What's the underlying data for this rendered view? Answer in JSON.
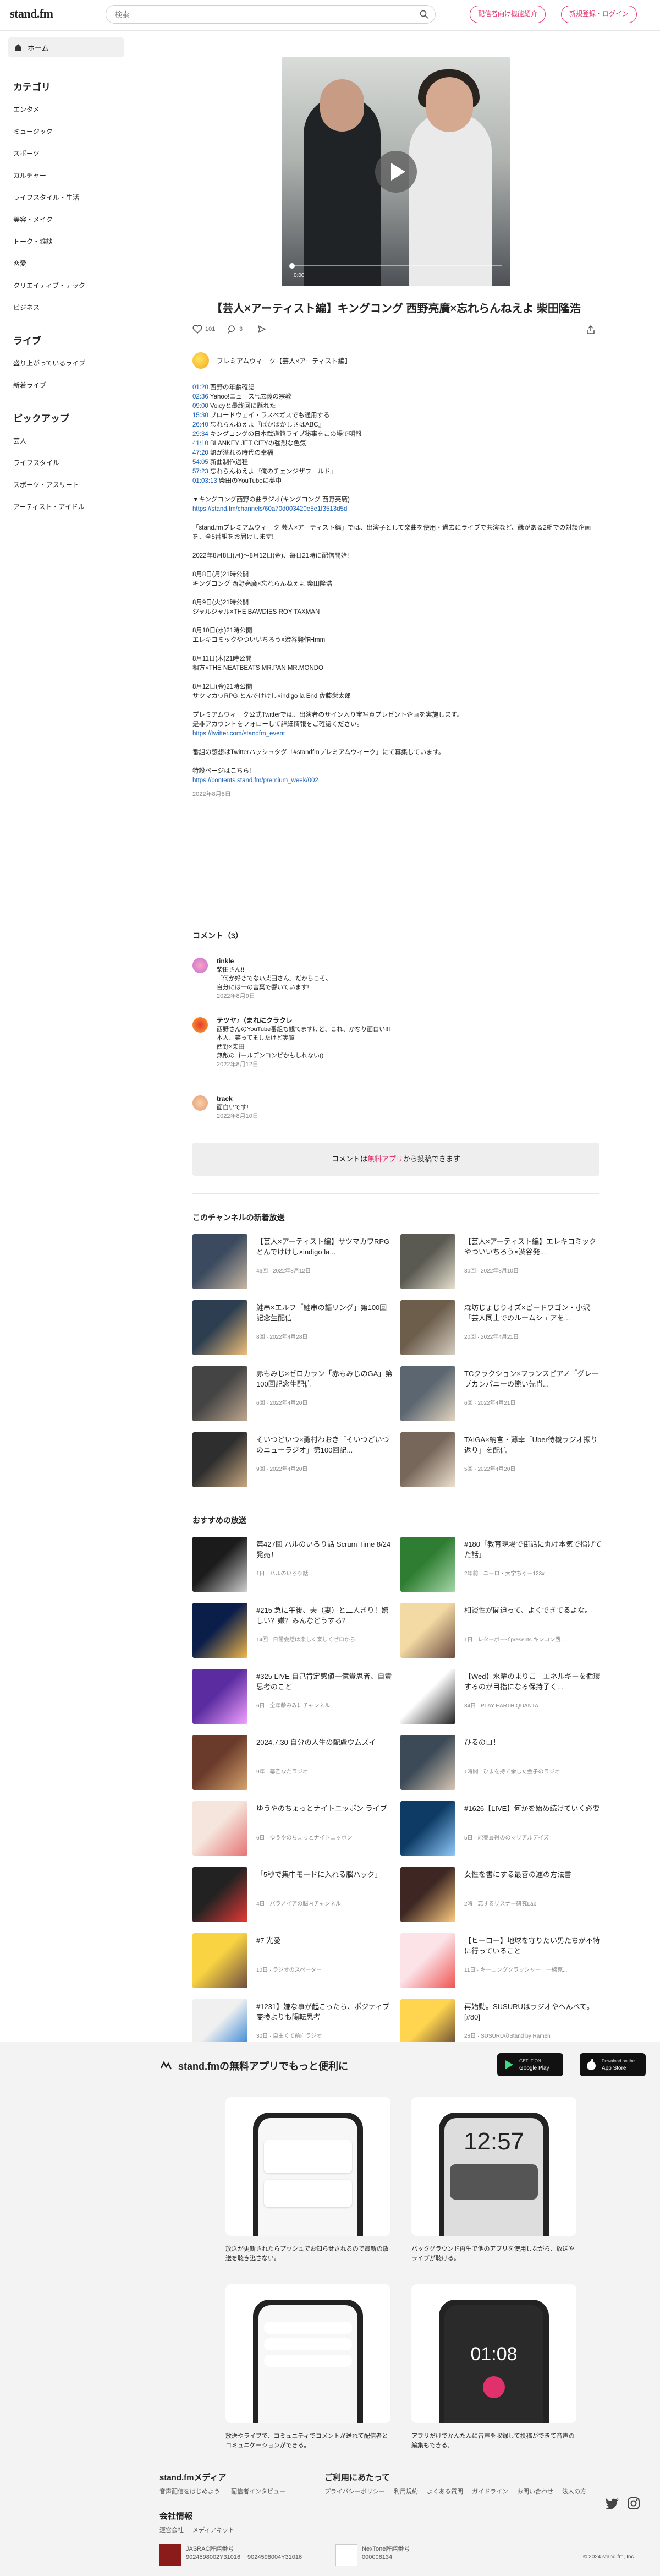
{
  "header": {
    "logo": "stand.fm",
    "search_placeholder": "検索",
    "btn_distributor": "配信者向け機能紹介",
    "btn_signup": "新規登録・ログイン"
  },
  "sidebar": {
    "home": "ホーム",
    "categories_title": "カテゴリ",
    "categories": [
      "エンタメ",
      "ミュージック",
      "スポーツ",
      "カルチャー",
      "ライフスタイル・生活",
      "美容・メイク",
      "トーク・雑談",
      "恋愛",
      "クリエイティブ・テック",
      "ビジネス"
    ],
    "live_title": "ライブ",
    "live": [
      "盛り上がっているライブ",
      "新着ライブ"
    ],
    "pickup_title": "ピックアップ",
    "pickup": [
      "芸人",
      "ライフスタイル",
      "スポーツ・アスリート",
      "アーティスト・アイドル"
    ]
  },
  "player": {
    "time": "0:00"
  },
  "episode": {
    "title": "【芸人×アーティスト編】キングコング 西野亮廣×忘れらんねえよ 柴田隆浩",
    "likes": "101",
    "comments": "3",
    "channel": "プレミアムウィーク【芸人×アーティスト編】"
  },
  "chapters": [
    {
      "t": "01:20",
      "s": "西野の年齢確認"
    },
    {
      "t": "02:36",
      "s": "Yahoo!ニュース≒広義の宗教"
    },
    {
      "t": "09:00",
      "s": "Voicyと最終回に懸れた"
    },
    {
      "t": "15:30",
      "s": "ブロードウェイ・ラスベガスでも通用する"
    },
    {
      "t": "26:40",
      "s": "忘れらんねえよ『ばかばかしさはABC』"
    },
    {
      "t": "29:34",
      "s": "キングコングの日本武道館ライブ秘事をこの場で明報"
    },
    {
      "t": "41:10",
      "s": "BLANKEY JET CITYの強烈な色気"
    },
    {
      "t": "47:20",
      "s": "熱が溢れる時代の幸福"
    },
    {
      "t": "54:05",
      "s": "新曲制作過程"
    },
    {
      "t": "57:23",
      "s": "忘れらんねえよ『俺のチェンジザワールド』"
    },
    {
      "t": "01:03:13",
      "s": "柴田のYouTubeに夢中"
    }
  ],
  "desc": {
    "music_head": "▼キングコング西野の曲ラジオ(キングコング 西野亮廣)",
    "music_url": "https://stand.fm/channels/60a70d003420e5e1f3513d5d",
    "p1": "「stand.fmプレミアムウィーク 芸人×アーティスト編」では、出演子として楽曲を使用・過去にライブで共演など、縁がある2組での対談企画を、全5番組をお届けします!",
    "p2": "2022年8月8日(月)〜8月12日(金)、毎日21時に配信開始!",
    "sched": [
      [
        "8月8日(月)21時公開",
        "キングコング 西野亮廣×忘れらんねえよ 柴田隆浩"
      ],
      [
        "8月9日(火)21時公開",
        "ジャルジャル×THE BAWDIES ROY TAXMAN"
      ],
      [
        "8月10日(水)21時公開",
        "エレキコミックやついいちろう×渋谷発作Hmm"
      ],
      [
        "8月11日(木)21時公開",
        "相方×THE NEATBEATS MR.PAN MR.MONDO"
      ],
      [
        "8月12日(金)21時公開",
        "サツマカワRPG とんでけけし×indigo la End 佐藤栄太郎"
      ]
    ],
    "p3": "プレミアムウィーク公式Twitterでは、出演者のサイン入り宝写真プレゼント企画を実施します。",
    "p3b": "是非アカウントをフォローして詳細情報をご確認ください。",
    "tw_url": "https://twitter.com/standfm_event",
    "p4": "番組の感想はTwitterハッシュタグ「#standfmプレミアムウィーク」にて募集しています。",
    "p5": "特設ページはこちら!",
    "special_url": "https://contents.stand.fm/premium_week/002",
    "date": "2022年8月8日"
  },
  "comments_title": "コメント（3）",
  "comments": [
    {
      "name": "tinkle",
      "lines": [
        "柴田さん!!",
        "「何か好きでない柴田さん」だからこそ、",
        "自分には一の言葉で響いています!"
      ],
      "date": "2022年8月9日"
    },
    {
      "name": "テツヤ♪（まれにクラクレ",
      "lines": [
        "西野さんのYouTube番組も観てますけど、これ、かなり面白い!!!",
        "本人、笑ってましたけど実質",
        "西野×柴田",
        "無敵のゴールデンコンビかもしれない()"
      ],
      "date": "2022年8月12日"
    },
    {
      "name": "track",
      "lines": [
        "面白いです!"
      ],
      "date": "2022年8月10日"
    }
  ],
  "comment_note": {
    "pre": "コメントは",
    "link": "無料アプリ",
    "post": "から投稿できます"
  },
  "new_title": "このチャンネルの新着放送",
  "new_items": [
    {
      "title": "【芸人×アーティスト編】サツマカワRPG とんでけけし×indigo la...",
      "meta": "46回 · 2022年8月12日"
    },
    {
      "title": "【芸人×アーティスト編】エレキコミックやついいちろう×渋谷発...",
      "meta": "30回 · 2022年8月10日"
    },
    {
      "title": "鮭串×エルフ「鮭串の語リング」第100回記念生配信",
      "meta": "8回 · 2022年4月28日"
    },
    {
      "title": "森坊じょじりオズ×ピードワゴン・小沢「芸人同士でのルームシェアを...",
      "meta": "20回 · 2022年4月21日"
    },
    {
      "title": "赤もみじ×ゼロカラン「赤もみじのGA」第100回記念生配信",
      "meta": "6回 · 2022年4月20日"
    },
    {
      "title": "TCクラクション×フランスピアノ「グレープカンパニーの熊い先肖...",
      "meta": "6回 · 2022年4月21日"
    },
    {
      "title": "そいつどいつ×勇村わおき「そいつどいつのニューラジオ」第100回記...",
      "meta": "9回 · 2022年4月20日"
    },
    {
      "title": "TAIGA×納言・薄幸「Uber待機ラジオ振り返り」を配信",
      "meta": "5回 · 2022年4月20日"
    }
  ],
  "rec_title": "おすすめの放送",
  "rec_items": [
    {
      "title": "第427回 ハルのいろり話 Scrum Time 8/24 発売！",
      "meta": "1日 · ハルのいろり話"
    },
    {
      "title": "#180「教育現場で街話に丸け本気で指げてた話」",
      "meta": "2年前 · ユーロ・大学ちゃー123x"
    },
    {
      "title": "#215 急に午後、夫（妻）と二人きり！嬉しい？嫌？みんなどうする？",
      "meta": "14回 · 日常会話は楽しく楽しくゼロから"
    },
    {
      "title": "相談性が関迫って、よくできてるよな。",
      "meta": "1日 · レターボーイpresents キンコン西..."
    },
    {
      "title": "#325 LIVE 自己肯定感値一億貴思者、自責思考のこと",
      "meta": "6日 · 全年齢みみにチャンネル"
    },
    {
      "title": "【Wed】水曜のまりこ　エネルギーを循環するのが目指になる保持子く...",
      "meta": "34日 · PLAY EARTH QUANTA"
    },
    {
      "title": "2024.7.30 自分の人生の配慮ウムズイ",
      "meta": "9年 · 幕乙なたラジオ"
    },
    {
      "title": "ひるのロ！",
      "meta": "1時間 · ひまを持て余した金子のラジオ"
    },
    {
      "title": "ゆうやのちょっとナイトニッポン ライブ",
      "meta": "6日 · ゆうやのちょっとナイトニッポン"
    },
    {
      "title": "#1626【LIVE】何かを始め続けていく必要",
      "meta": "5日 · 能美最得ののマリアルデイズ"
    },
    {
      "title": "「5秒で集中モードに入れる脳ハック」",
      "meta": "4日 · パラノイアの脳内チャンネル"
    },
    {
      "title": "女性を書にする最善の運の方法書",
      "meta": "2時 · 恋するリスナー研究Lab"
    },
    {
      "title": "#7 光愛",
      "meta": "10日 · ラジオのスペーター"
    },
    {
      "title": "【ヒーロー】地球を守りたい男たちが不特に行っていること",
      "meta": "11日 · キーニングクラッシャー　一線克..."
    },
    {
      "title": "#1231】嫌な事が起こったら、ポジティブ変換よりも陽転思考",
      "meta": "30日 · 自由くて前向ラジオ"
    },
    {
      "title": "再始動。SUSURUはラジオやへんべて。[#80]",
      "meta": "28日 · SUSURUのStand by Ramen"
    }
  ],
  "footer": {
    "app_title": "stand.fmの無料アプリでもっと便利に",
    "gp_small": "GET IT ON",
    "gp": "Google Play",
    "as_small": "Download on the",
    "as": "App Store",
    "clock": "12:57",
    "rec_time": "01:08",
    "features": [
      "放送が更新されたらプッシュでお知らせされるので最新の放送を聴き逃さない。",
      "バックグラウンド再生で他のアプリを使用しながら、放送やライブが聴ける。",
      "放送やライブで、コミュニティでコメントが送れて配信者とコミュニケーションができる。",
      "アプリだけでかんたんに音声を収録して投稿ができて音声の編集もできる。"
    ],
    "media_title": "stand.fmメディア",
    "media_links": [
      "音声配信をはじめよう",
      "配信者インタビュー"
    ],
    "guide_title": "ご利用にあたって",
    "guide_links": [
      "プライバシーポリシー",
      "利用規約",
      "よくある質問",
      "ガイドライン",
      "お問い合わせ",
      "法人の方"
    ],
    "company_title": "会社情報",
    "company_links": [
      "運営会社",
      "メディアキット"
    ],
    "jasrac_label": "JASRAC許諾番号",
    "jasrac_nums": [
      "9024598002Y31016",
      "9024598004Y31016"
    ],
    "nextone_label": "NexTone許諾番号",
    "nextone_num": "000006134",
    "copyright": "© 2024 stand.fm, Inc."
  }
}
